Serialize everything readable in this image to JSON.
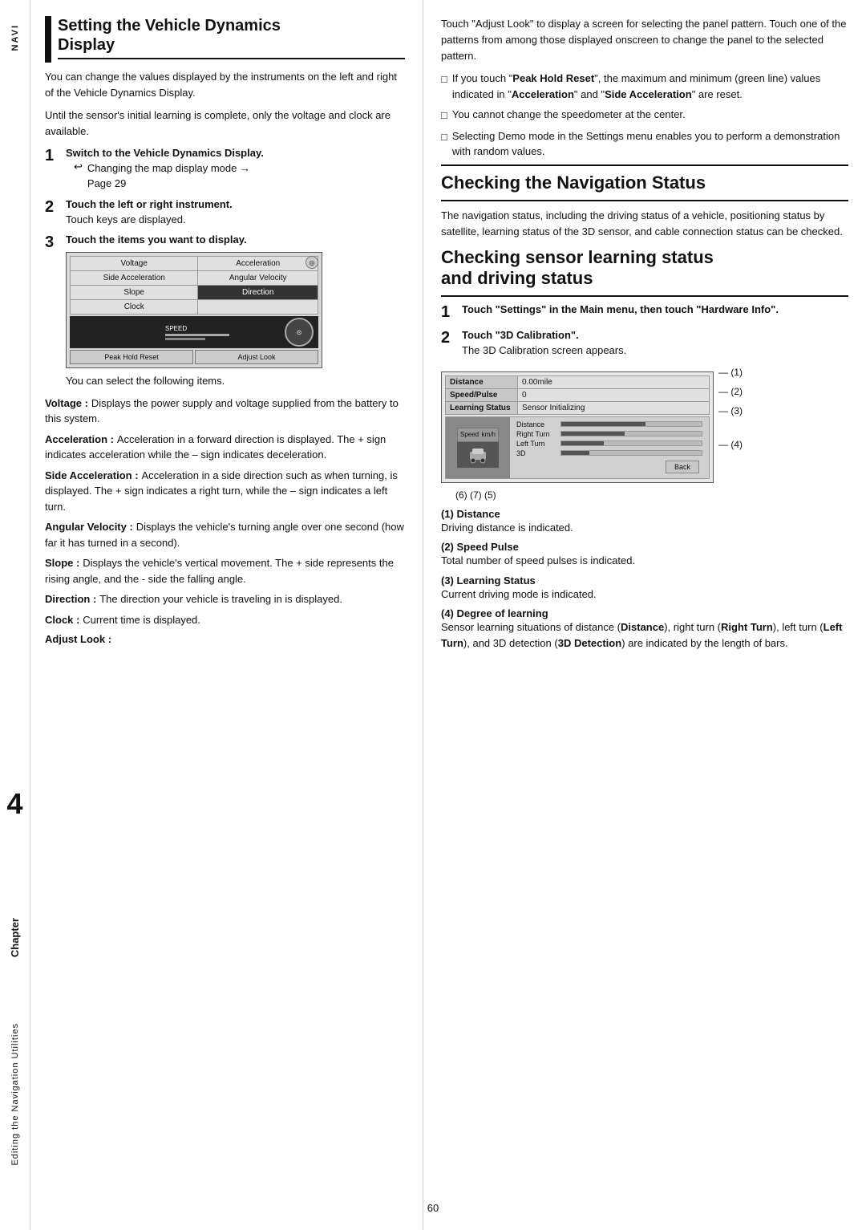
{
  "spine": {
    "navi_label": "NAVI",
    "chapter_label": "Chapter",
    "chapter_number": "4",
    "editing_label": "Editing the Navigation Utilities"
  },
  "left_column": {
    "section_title_line1": "Setting the Vehicle Dynamics",
    "section_title_line2": "Display",
    "intro_para1": "You can change the values displayed by the instruments on the left and right of the Vehicle Dynamics Display.",
    "intro_para2": "Until the sensor's initial learning is complete, only the voltage and clock are available.",
    "step1_title": "Switch to the Vehicle Dynamics Display.",
    "step1_sub": "Changing the map display mode →",
    "step1_page": "Page 29",
    "step2_title": "Touch the left or right instrument.",
    "step2_body": "Touch keys are displayed.",
    "step3_title": "Touch the items you want to display.",
    "step3_note": "You can select the following items.",
    "screen_buttons": [
      "Voltage",
      "Acceleration",
      "Side Acceleration",
      "Angular Velocity",
      "Slope",
      "Direction",
      "Clock",
      "",
      "Peak Hold Reset",
      "Adjust Look"
    ],
    "terms": [
      {
        "title": "Voltage :",
        "body": "Displays the power supply and voltage supplied from the battery to this system."
      },
      {
        "title": "Acceleration :",
        "body": "Acceleration in a forward direction is displayed. The + sign indicates acceleration while the – sign indicates deceleration."
      },
      {
        "title": "Side Acceleration :",
        "body": "Acceleration in a side direction such as when turning, is displayed. The + sign indicates a right turn, while the – sign indicates a left turn."
      },
      {
        "title": "Angular Velocity :",
        "body": "Displays the vehicle's turning angle over one second (how far it has turned in a second)."
      },
      {
        "title": "Slope :",
        "body": "Displays the vehicle's vertical movement. The + side represents the rising angle, and the - side the falling angle."
      },
      {
        "title": "Direction :",
        "body": "The direction your vehicle is traveling in is displayed."
      },
      {
        "title": "Clock :",
        "body": "Current time is displayed."
      },
      {
        "title": "Adjust Look :",
        "body": ""
      }
    ]
  },
  "right_column": {
    "adjust_look_body": "Touch \"Adjust Look\" to display a screen for selecting the panel pattern. Touch one of the patterns from among those displayed onscreen to change the panel to the selected pattern.",
    "checkbox_items": [
      {
        "text_before": "If you touch \"",
        "bold_text": "Peak Hold Reset",
        "text_after": "\", the maximum and minimum (green line) values indicated in \"",
        "bold2": "Acceleration",
        "text_after2": "\" and \"",
        "bold3": "Side Acceleration",
        "text_after3": "\" are reset."
      },
      {
        "plain_text": "You cannot change the speedometer at the center."
      },
      {
        "plain_text": "Selecting Demo mode in the Settings menu enables you to perform a demonstration with random values."
      }
    ],
    "nav_status_title": "Checking the Navigation Status",
    "nav_status_body": "The navigation status, including the driving status of a vehicle, positioning status by satellite, learning status of the 3D sensor, and cable connection status can be checked.",
    "sensor_title": "Checking sensor learning status and driving status",
    "step1_title": "Touch \"Settings\" in the Main menu, then touch \"Hardware Info\".",
    "step2_title": "Touch \"3D Calibration\".",
    "step2_body": "The 3D Calibration screen appears.",
    "calib_rows": [
      {
        "label": "Distance",
        "value": "0.00mile",
        "annot": "(1)"
      },
      {
        "label": "Speed/Pulse",
        "value": "0",
        "annot": "(2)"
      },
      {
        "label": "Learning Status",
        "value": "Sensor Initializing",
        "annot": "(3)"
      }
    ],
    "bar_rows": [
      {
        "label": "Distance",
        "fill_pct": 60
      },
      {
        "label": "Right Turn",
        "fill_pct": 45
      },
      {
        "label": "Left Turn",
        "fill_pct": 30
      },
      {
        "label": "3D",
        "fill_pct": 20
      }
    ],
    "annot4": "(4)",
    "calib_bottom_annots": "(6)   (7)   (5)",
    "annot_titles": [
      {
        "num": "(1) Distance",
        "body": "Driving distance is indicated."
      },
      {
        "num": "(2) Speed Pulse",
        "body": "Total number of speed pulses is indicated."
      },
      {
        "num": "(3) Learning Status",
        "body": "Current driving mode is indicated."
      },
      {
        "num": "(4) Degree of learning",
        "body_before": "Sensor learning situations of distance (",
        "bold1": "Distance",
        "text1": "), right turn (",
        "bold2": "Right Turn",
        "text2": "), left turn (",
        "bold3": "Left Turn",
        "text3": "), and 3D detection (",
        "bold4": "3D Detection",
        "text4": ") are indicated by the length of bars."
      }
    ],
    "back_btn": "Back"
  },
  "page_number": "60"
}
